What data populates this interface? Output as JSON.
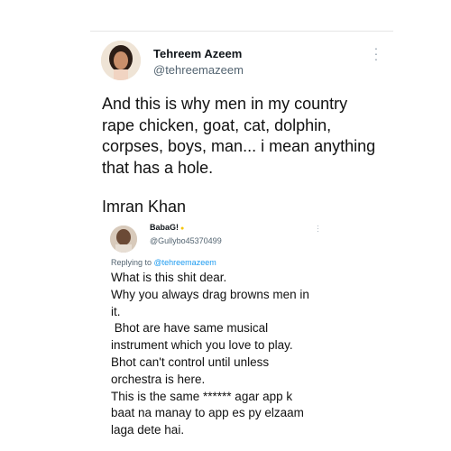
{
  "tweet": {
    "author_name": "Tehreem Azeem",
    "author_handle": "@tehreemazeem",
    "text_lines": [
      "And this is why men in my country",
      "rape chicken, goat, cat, dolphin,",
      "corpses, boys, man... i mean anything",
      "that has a hole."
    ],
    "signature": "Imran Khan"
  },
  "reply": {
    "author_name": "BabaG!",
    "author_handle": "@Gullybo45370499",
    "replying_prefix": "Replying to ",
    "replying_to": "@tehreemazeem",
    "text_lines": [
      "What is this shit dear.",
      "Why you always drag browns men in",
      "it.",
      " Bhot are have same musical",
      "instrument which you love to play.",
      "Bhot can't control until unless",
      "orchestra is here.",
      "This is the same ****** agar app k",
      "baat na manay to app es py elzaam",
      "laga dete hai."
    ]
  },
  "icons": {
    "more": "more-vertical-icon",
    "verified_dot": "yellow-dot-icon"
  }
}
